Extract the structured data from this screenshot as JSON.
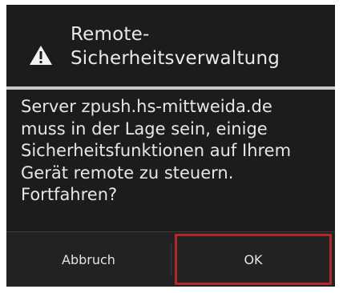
{
  "dialog": {
    "icon": "warning-icon",
    "title": "Remote-\nSicherheitsverwaltung",
    "title_line1": "Remote-",
    "title_line2": "Sicherheitsverwaltung",
    "message_lines": [
      "Server zpush.hs-mittweida.de",
      "muss in der Lage sein, einige",
      "Sicherheitsfunktionen auf Ihrem",
      "Gerät remote zu steuern.",
      "Fortfahren?"
    ],
    "buttons": {
      "cancel_label": "Abbruch",
      "ok_label": "OK"
    }
  },
  "colors": {
    "dialog_background": "#1c1c1c",
    "divider": "#c8c8c8",
    "highlight_border": "#b3272d",
    "text": "#e6e6e6"
  }
}
